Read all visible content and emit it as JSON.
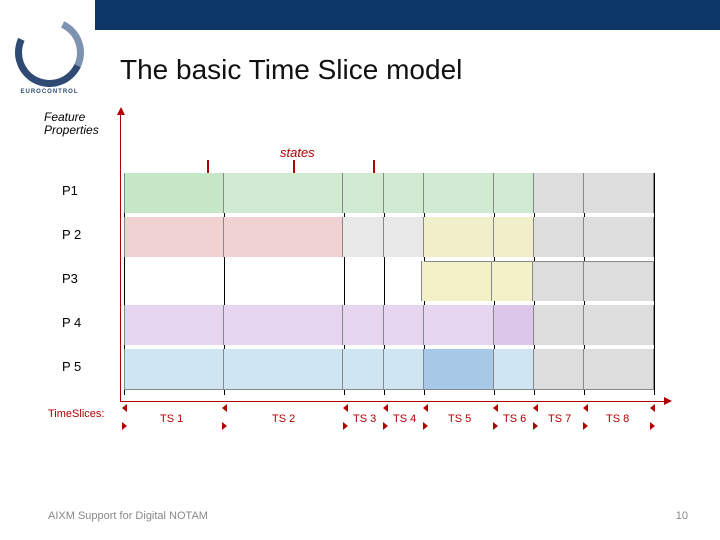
{
  "logo_text": "EUROCONTROL",
  "title": "The basic Time Slice model",
  "yaxis_label_l1": "Feature",
  "yaxis_label_l2": "Properties",
  "states_label": "states",
  "rows": [
    "P1",
    "P 2",
    "P3",
    "P 4",
    "P 5"
  ],
  "xaxis_label": "TimeSlices:",
  "timeslices": [
    "TS 1",
    "TS 2",
    "TS 3",
    "TS 4",
    "TS 5",
    "TS 6",
    "TS 7",
    "TS 8"
  ],
  "footer_left": "AIXM Support for Digital NOTAM",
  "page_num": "10",
  "chart_data": {
    "type": "table",
    "title": "The basic Time Slice model",
    "xlabel": "TimeSlices",
    "ylabel": "Feature Properties",
    "boundaries_pct": [
      0,
      18.9,
      41.5,
      49.1,
      56.6,
      69.8,
      77.4,
      86.8,
      100
    ],
    "slice_labels": [
      "TS 1",
      "TS 2",
      "TS 3",
      "TS 4",
      "TS 5",
      "TS 6",
      "TS 7",
      "TS 8"
    ],
    "properties": {
      "P1": {
        "present": [
          1,
          2,
          3,
          4,
          5,
          6,
          7,
          8
        ],
        "color": "green"
      },
      "P2": {
        "present": [
          1,
          2,
          3,
          4,
          5,
          6,
          7,
          8
        ],
        "color": "red"
      },
      "P3": {
        "present": [
          5,
          6,
          7,
          8
        ],
        "color": "yellow"
      },
      "P4": {
        "present": [
          1,
          2,
          3,
          4,
          5,
          6,
          7,
          8
        ],
        "color": "purple"
      },
      "P5": {
        "present": [
          1,
          2,
          3,
          4,
          5,
          6,
          7,
          8
        ],
        "color": "blue"
      }
    }
  }
}
